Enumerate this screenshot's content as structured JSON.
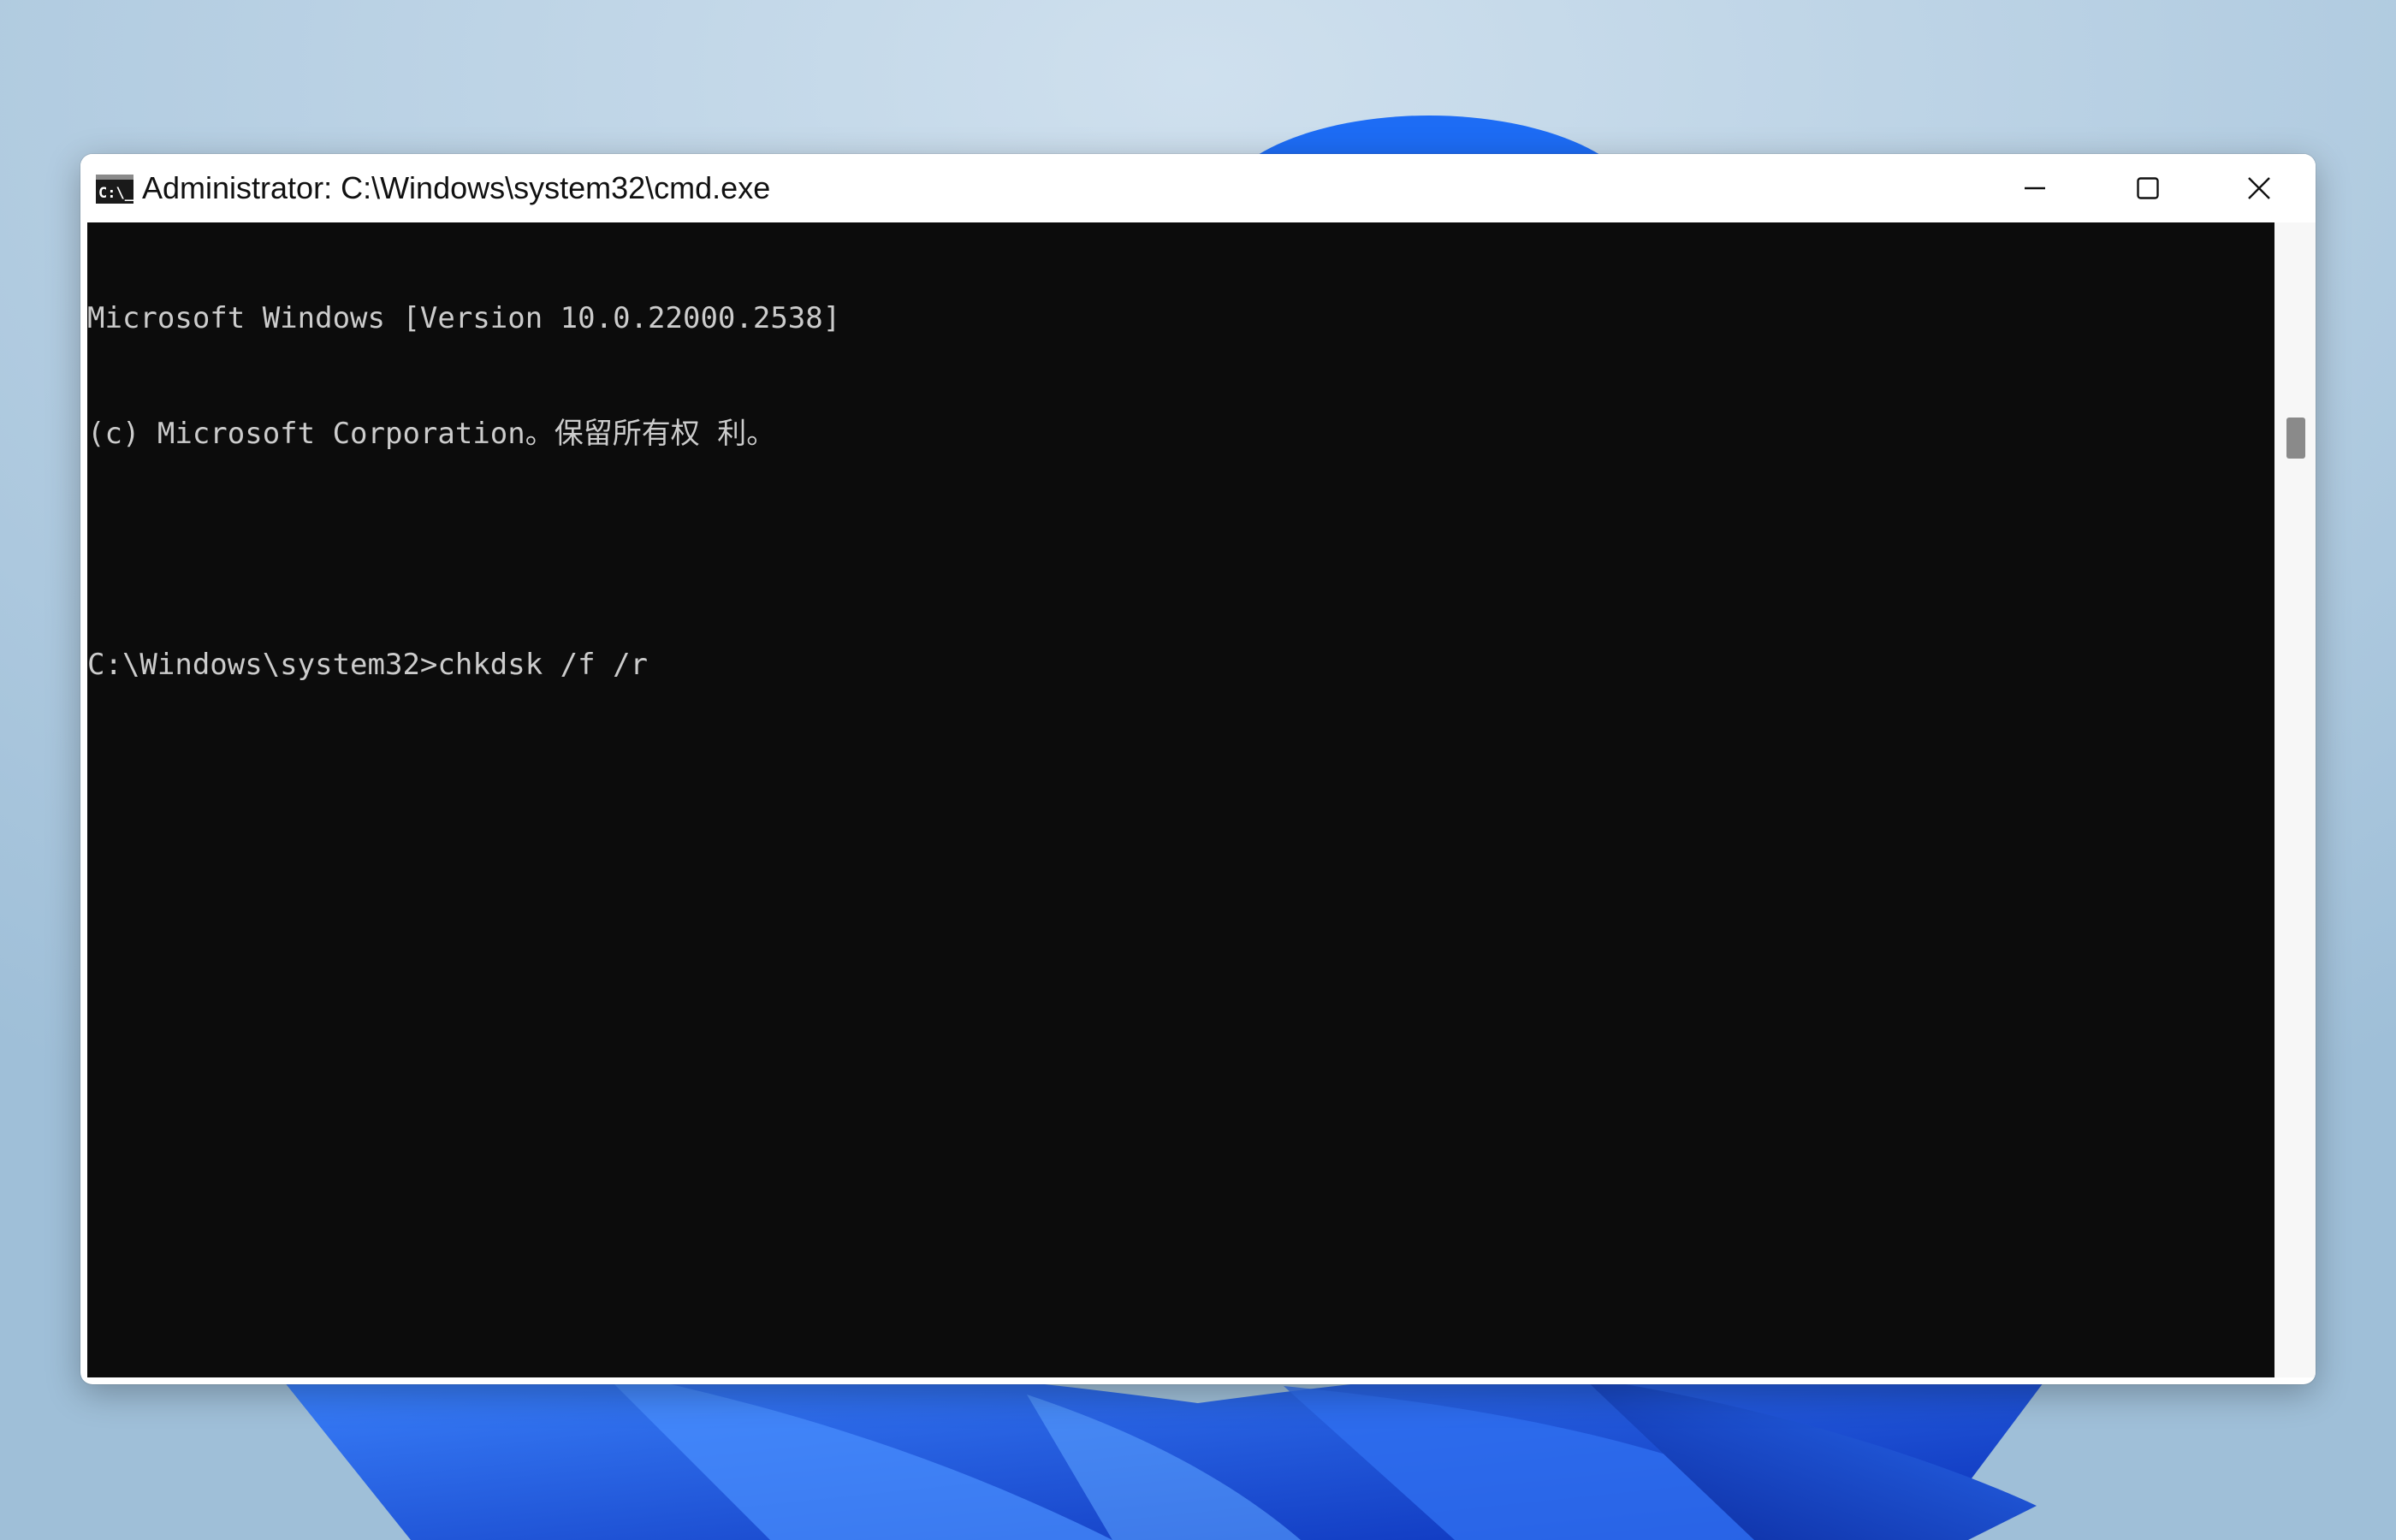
{
  "window": {
    "title": "Administrator: C:\\Windows\\system32\\cmd.exe",
    "icon": "cmd-icon",
    "icon_glyph": "C:\\_"
  },
  "caption_buttons": {
    "minimize_icon": "minimize-icon",
    "maximize_icon": "maximize-icon",
    "close_icon": "close-icon"
  },
  "console": {
    "lines": [
      "Microsoft Windows [Version 10.0.22000.2538]",
      "(c) Microsoft Corporation。保留所有权 利。",
      "",
      "C:\\Windows\\system32>chkdsk /f /r"
    ],
    "background": "#0c0c0c",
    "foreground": "#cccccc"
  },
  "colors": {
    "wallpaper_sky": "#b7d2e6",
    "wallpaper_bloom": "#1a56e8",
    "titlebar": "#ffffff"
  }
}
